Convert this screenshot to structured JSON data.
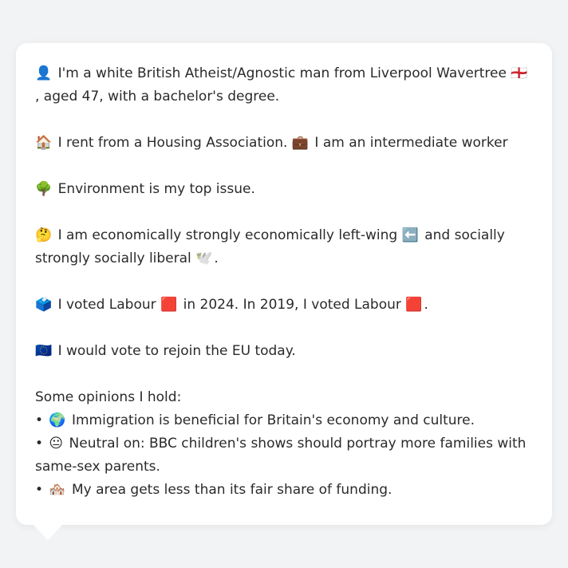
{
  "profile": {
    "intro_emoji": "👤",
    "intro_text": "I'm a white British Atheist/Agnostic man from Liverpool Wavertree",
    "intro_flag": "🏴󠁧󠁢󠁥󠁮󠁧󠁿",
    "intro_cont": ", aged 47, with a bachelor's degree.",
    "housing_emoji": "🏠",
    "housing_text": "I rent from a Housing Association.",
    "work_emoji": "💼",
    "work_text": "I am an intermediate worker",
    "issue_emoji": "🌳",
    "issue_text": "Environment is my top issue.",
    "politics_emoji": "🤔",
    "politics_text": "I am economically strongly economically left-wing",
    "left_emoji": "⬅️",
    "politics_cont": "and socially strongly socially liberal",
    "dove_emoji": "🕊️",
    "politics_end": ".",
    "vote_emoji": "🗳️",
    "vote_text_1": "I voted Labour",
    "labour_emoji_1": "🟥",
    "vote_text_2": "in 2024. In 2019, I voted Labour",
    "labour_emoji_2": "🟥",
    "vote_end": ".",
    "eu_emoji": "🇪🇺",
    "eu_text": "I would vote to rejoin the EU today.",
    "opinions_heading": "Some opinions I hold:",
    "bullet": "•",
    "opinions": [
      {
        "emoji": "🌍",
        "text": "Immigration is beneficial for Britain's economy and culture."
      },
      {
        "emoji": "😐",
        "text": "Neutral on: BBC children's shows should portray more families with same-sex parents."
      },
      {
        "emoji": "🏘️",
        "text": "My area gets less than its fair share of funding."
      }
    ]
  }
}
